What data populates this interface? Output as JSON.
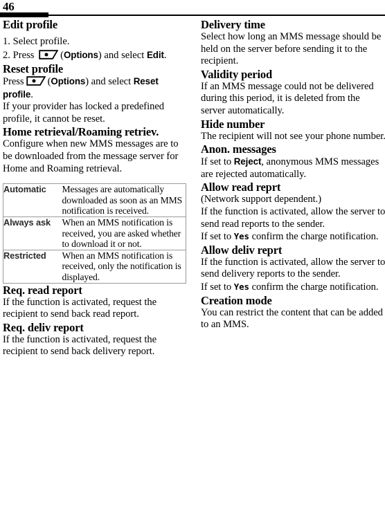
{
  "page": {
    "folio": "46"
  },
  "left_column": {
    "sections": [
      {
        "heading": "Edit profile",
        "steps": [
          {
            "num": "1.",
            "text_before": "Select profile.",
            "has_key": false
          },
          {
            "num": "2.",
            "text_before": "Press",
            "has_key": true,
            "paren_open": "(",
            "ui_1": "Options",
            "paren_close": ")",
            "text_mid": " and select ",
            "ui_2": "Edit",
            "text_after": "."
          }
        ]
      },
      {
        "heading": "Reset profile",
        "press_line": {
          "text_before": "Press",
          "paren_open": "(",
          "ui_1": "Options",
          "paren_close": ")",
          "text_mid": " and select ",
          "ui_2": "Reset profile",
          "text_after": "."
        },
        "paragraph": "If your provider has locked a predefined profile, it cannot be reset."
      },
      {
        "heading": "Home retrieval/Roaming retriev.",
        "paragraph": "Configure when new MMS messages are to be downloaded from the message server for Home and Roaming retrieval.",
        "table": {
          "rows": [
            {
              "key": "Automatic",
              "value": "Messages are automatically downloaded as soon as an MMS notification is received."
            },
            {
              "key": "Always ask",
              "value": "When an MMS notification is received, you are asked whether to download it or not."
            },
            {
              "key": "Restricted",
              "value": "When an MMS notification is received, only the notification is displayed."
            }
          ]
        }
      },
      {
        "heading": "Req. read report",
        "paragraph": "If the function is activated, request the recipient to send back read report."
      },
      {
        "heading": "Req. deliv report",
        "paragraph": "If the function is activated, request the recipient to send back delivery report."
      }
    ]
  },
  "right_column": {
    "sections": [
      {
        "heading": "Delivery time",
        "paragraph": "Select how long an MMS message should be held on the server before sending it to the recipient."
      },
      {
        "heading": "Validity period",
        "paragraph": "If an MMS message could not be delivered during this period, it is deleted from the server automatically."
      },
      {
        "heading": "Hide number",
        "paragraph": "The recipient will not see your phone number."
      },
      {
        "heading": "Anon. messages",
        "paragraph_before": "If set to ",
        "ui_term": "Reject",
        "paragraph_after": ", anonymous MMS messages are rejected automatically."
      },
      {
        "heading": "Allow read reprt",
        "paragraph_1": "(Network support dependent.)",
        "paragraph_2": "If the function is activated, allow the server to send read reports to the sender.",
        "paragraph_3_before": "If set to ",
        "ui_term": "Yes",
        "paragraph_3_after": " confirm the charge notification."
      },
      {
        "heading": "Allow deliv reprt",
        "paragraph_1": "If the function is activated, allow the server to send delivery reports to the sender.",
        "paragraph_2_before": "If set to ",
        "ui_term": "Yes",
        "paragraph_2_after": " confirm the charge notification."
      },
      {
        "heading": "Creation mode",
        "paragraph": "You can restrict the content that can be added to an MMS."
      }
    ]
  },
  "icons": {
    "softkey": "left-softkey-icon"
  }
}
